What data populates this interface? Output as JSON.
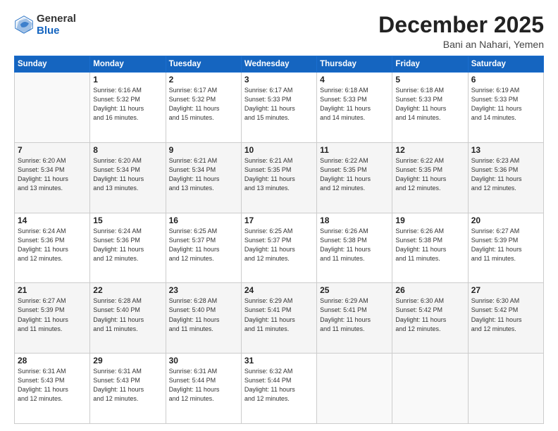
{
  "header": {
    "logo": {
      "general": "General",
      "blue": "Blue"
    },
    "title": "December 2025",
    "subtitle": "Bani an Nahari, Yemen"
  },
  "weekdays": [
    "Sunday",
    "Monday",
    "Tuesday",
    "Wednesday",
    "Thursday",
    "Friday",
    "Saturday"
  ],
  "weeks": [
    [
      {
        "day": "",
        "info": ""
      },
      {
        "day": "1",
        "info": "Sunrise: 6:16 AM\nSunset: 5:32 PM\nDaylight: 11 hours\nand 16 minutes."
      },
      {
        "day": "2",
        "info": "Sunrise: 6:17 AM\nSunset: 5:32 PM\nDaylight: 11 hours\nand 15 minutes."
      },
      {
        "day": "3",
        "info": "Sunrise: 6:17 AM\nSunset: 5:33 PM\nDaylight: 11 hours\nand 15 minutes."
      },
      {
        "day": "4",
        "info": "Sunrise: 6:18 AM\nSunset: 5:33 PM\nDaylight: 11 hours\nand 14 minutes."
      },
      {
        "day": "5",
        "info": "Sunrise: 6:18 AM\nSunset: 5:33 PM\nDaylight: 11 hours\nand 14 minutes."
      },
      {
        "day": "6",
        "info": "Sunrise: 6:19 AM\nSunset: 5:33 PM\nDaylight: 11 hours\nand 14 minutes."
      }
    ],
    [
      {
        "day": "7",
        "info": "Sunrise: 6:20 AM\nSunset: 5:34 PM\nDaylight: 11 hours\nand 13 minutes."
      },
      {
        "day": "8",
        "info": "Sunrise: 6:20 AM\nSunset: 5:34 PM\nDaylight: 11 hours\nand 13 minutes."
      },
      {
        "day": "9",
        "info": "Sunrise: 6:21 AM\nSunset: 5:34 PM\nDaylight: 11 hours\nand 13 minutes."
      },
      {
        "day": "10",
        "info": "Sunrise: 6:21 AM\nSunset: 5:35 PM\nDaylight: 11 hours\nand 13 minutes."
      },
      {
        "day": "11",
        "info": "Sunrise: 6:22 AM\nSunset: 5:35 PM\nDaylight: 11 hours\nand 12 minutes."
      },
      {
        "day": "12",
        "info": "Sunrise: 6:22 AM\nSunset: 5:35 PM\nDaylight: 11 hours\nand 12 minutes."
      },
      {
        "day": "13",
        "info": "Sunrise: 6:23 AM\nSunset: 5:36 PM\nDaylight: 11 hours\nand 12 minutes."
      }
    ],
    [
      {
        "day": "14",
        "info": "Sunrise: 6:24 AM\nSunset: 5:36 PM\nDaylight: 11 hours\nand 12 minutes."
      },
      {
        "day": "15",
        "info": "Sunrise: 6:24 AM\nSunset: 5:36 PM\nDaylight: 11 hours\nand 12 minutes."
      },
      {
        "day": "16",
        "info": "Sunrise: 6:25 AM\nSunset: 5:37 PM\nDaylight: 11 hours\nand 12 minutes."
      },
      {
        "day": "17",
        "info": "Sunrise: 6:25 AM\nSunset: 5:37 PM\nDaylight: 11 hours\nand 12 minutes."
      },
      {
        "day": "18",
        "info": "Sunrise: 6:26 AM\nSunset: 5:38 PM\nDaylight: 11 hours\nand 11 minutes."
      },
      {
        "day": "19",
        "info": "Sunrise: 6:26 AM\nSunset: 5:38 PM\nDaylight: 11 hours\nand 11 minutes."
      },
      {
        "day": "20",
        "info": "Sunrise: 6:27 AM\nSunset: 5:39 PM\nDaylight: 11 hours\nand 11 minutes."
      }
    ],
    [
      {
        "day": "21",
        "info": "Sunrise: 6:27 AM\nSunset: 5:39 PM\nDaylight: 11 hours\nand 11 minutes."
      },
      {
        "day": "22",
        "info": "Sunrise: 6:28 AM\nSunset: 5:40 PM\nDaylight: 11 hours\nand 11 minutes."
      },
      {
        "day": "23",
        "info": "Sunrise: 6:28 AM\nSunset: 5:40 PM\nDaylight: 11 hours\nand 11 minutes."
      },
      {
        "day": "24",
        "info": "Sunrise: 6:29 AM\nSunset: 5:41 PM\nDaylight: 11 hours\nand 11 minutes."
      },
      {
        "day": "25",
        "info": "Sunrise: 6:29 AM\nSunset: 5:41 PM\nDaylight: 11 hours\nand 11 minutes."
      },
      {
        "day": "26",
        "info": "Sunrise: 6:30 AM\nSunset: 5:42 PM\nDaylight: 11 hours\nand 12 minutes."
      },
      {
        "day": "27",
        "info": "Sunrise: 6:30 AM\nSunset: 5:42 PM\nDaylight: 11 hours\nand 12 minutes."
      }
    ],
    [
      {
        "day": "28",
        "info": "Sunrise: 6:31 AM\nSunset: 5:43 PM\nDaylight: 11 hours\nand 12 minutes."
      },
      {
        "day": "29",
        "info": "Sunrise: 6:31 AM\nSunset: 5:43 PM\nDaylight: 11 hours\nand 12 minutes."
      },
      {
        "day": "30",
        "info": "Sunrise: 6:31 AM\nSunset: 5:44 PM\nDaylight: 11 hours\nand 12 minutes."
      },
      {
        "day": "31",
        "info": "Sunrise: 6:32 AM\nSunset: 5:44 PM\nDaylight: 11 hours\nand 12 minutes."
      },
      {
        "day": "",
        "info": ""
      },
      {
        "day": "",
        "info": ""
      },
      {
        "day": "",
        "info": ""
      }
    ]
  ]
}
